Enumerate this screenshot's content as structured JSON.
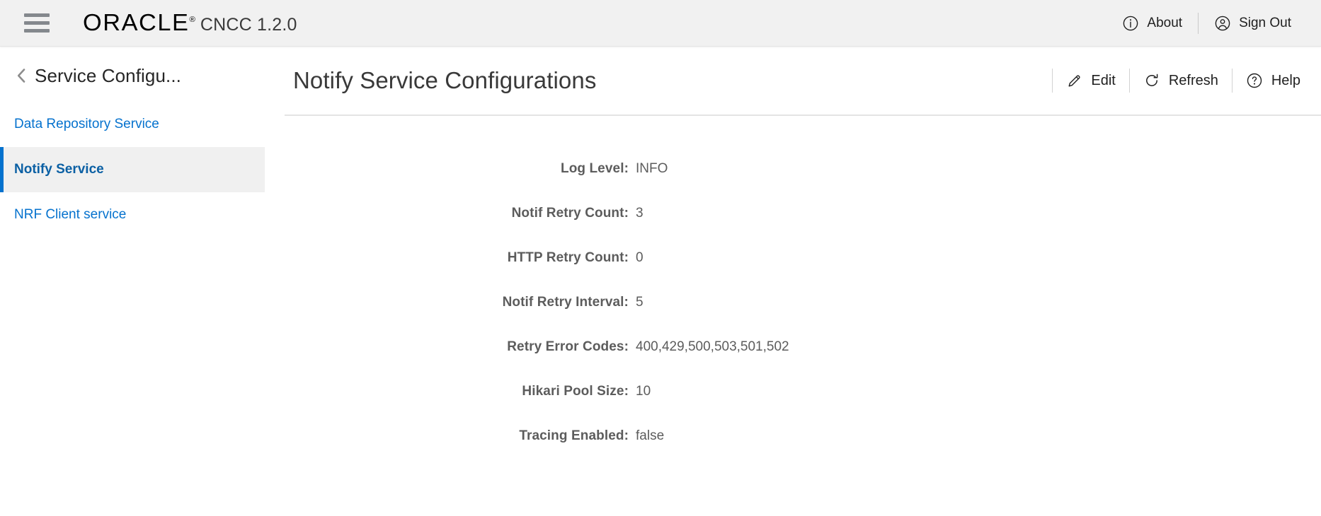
{
  "header": {
    "menu_icon": "hamburger-menu-icon",
    "brand": "ORACLE",
    "brand_registered": "®",
    "product": "CNCC 1.2.0",
    "about_label": "About",
    "about_icon": "info-circle-icon",
    "signout_label": "Sign Out",
    "signout_icon": "user-circle-icon"
  },
  "sidebar": {
    "back_icon": "chevron-left-icon",
    "title": "Service Configu...",
    "items": [
      {
        "label": "Data Repository Service",
        "selected": false
      },
      {
        "label": "Notify Service",
        "selected": true
      },
      {
        "label": "NRF Client service",
        "selected": false
      }
    ]
  },
  "main": {
    "title": "Notify Service Configurations",
    "actions": [
      {
        "label": "Edit",
        "icon": "pencil-icon"
      },
      {
        "label": "Refresh",
        "icon": "refresh-icon"
      },
      {
        "label": "Help",
        "icon": "question-circle-icon"
      }
    ],
    "fields": [
      {
        "label": "Log Level:",
        "value": "INFO"
      },
      {
        "label": "Notif Retry Count:",
        "value": "3"
      },
      {
        "label": "HTTP Retry Count:",
        "value": "0"
      },
      {
        "label": "Notif Retry Interval:",
        "value": "5"
      },
      {
        "label": "Retry Error Codes:",
        "value": "400,429,500,503,501,502"
      },
      {
        "label": "Hikari Pool Size:",
        "value": "10"
      },
      {
        "label": "Tracing Enabled:",
        "value": "false"
      }
    ]
  },
  "colors": {
    "accent": "#0572ce",
    "link": "#0572ce",
    "selected_bg": "#f0f0f0",
    "header_bg": "#f1f1f1",
    "label_text": "#5c5c5c",
    "title_text": "#393939"
  }
}
